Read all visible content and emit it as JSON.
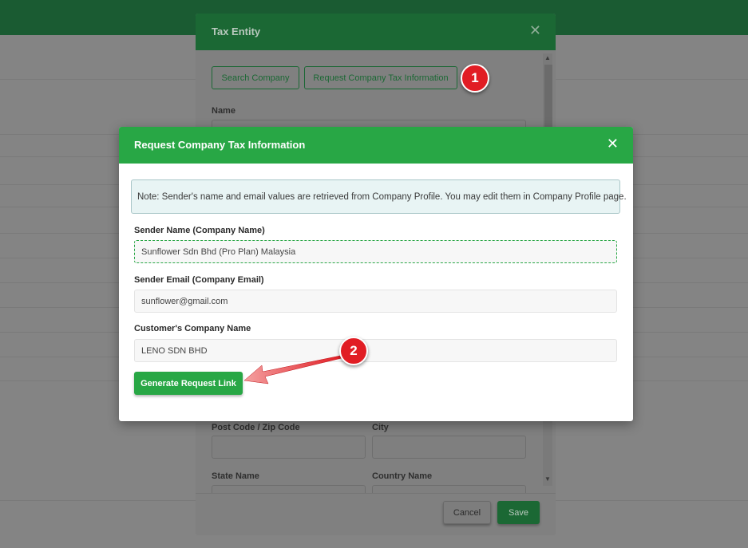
{
  "tax_entity_modal": {
    "title": "Tax Entity",
    "close_glyph": "✕",
    "buttons": {
      "search_company": "Search Company",
      "request_company_tax_info": "Request Company Tax Information"
    },
    "fields": {
      "name_label": "Name",
      "post_code_label": "Post Code / Zip Code",
      "city_label": "City",
      "state_name_label": "State Name",
      "country_name_label": "Country Name"
    },
    "footer": {
      "cancel": "Cancel",
      "save": "Save"
    }
  },
  "request_modal": {
    "title": "Request Company Tax Information",
    "close_glyph": "✕",
    "note": "Note: Sender's name and email values are retrieved from Company Profile. You may edit them in Company Profile page.",
    "sender_name_label": "Sender Name (Company Name)",
    "sender_name_value": "Sunflower Sdn Bhd (Pro Plan) Malaysia",
    "sender_email_label": "Sender Email (Company Email)",
    "sender_email_value": "sunflower@gmail.com",
    "customer_company_label": "Customer's Company Name",
    "customer_company_value": "LENO SDN BHD",
    "generate_button": "Generate Request Link"
  },
  "callouts": {
    "step1": "1",
    "step2": "2"
  },
  "colors": {
    "primary_green": "#28a745",
    "dark_green": "#1a5b32",
    "callout_red": "#e11d24"
  }
}
